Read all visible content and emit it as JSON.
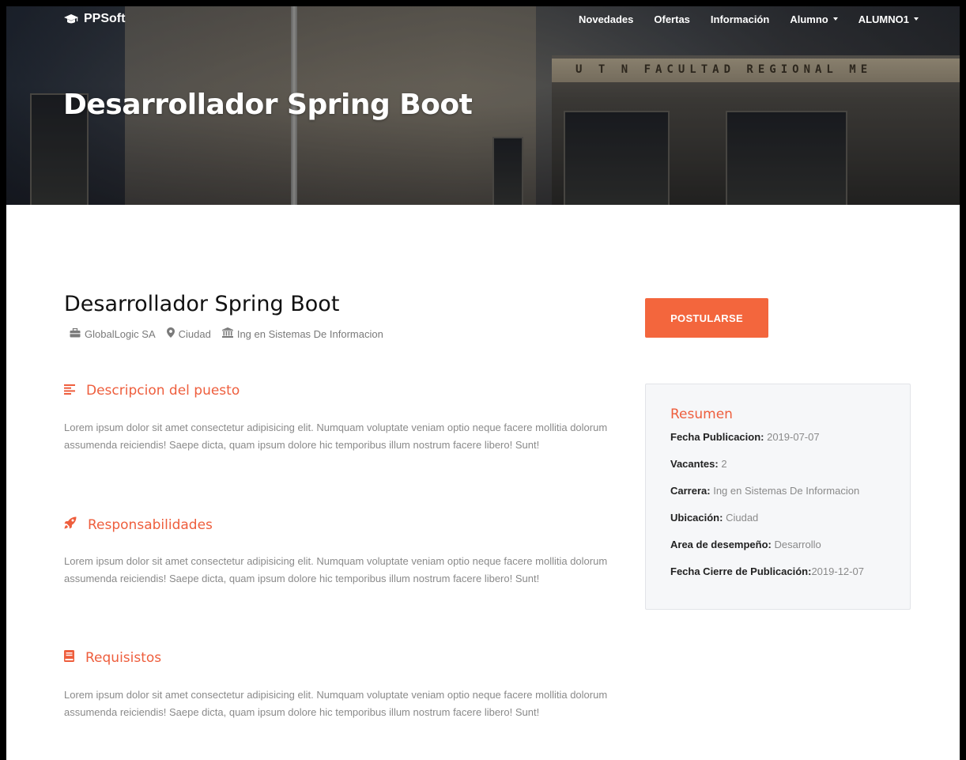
{
  "nav": {
    "brand": "PPSoft",
    "items": [
      {
        "label": "Novedades"
      },
      {
        "label": "Ofertas"
      },
      {
        "label": "Información"
      },
      {
        "label": "Alumno"
      },
      {
        "label": "ALUMNO1"
      }
    ]
  },
  "hero": {
    "title": "Desarrollador Spring Boot",
    "sign_text": "U T N   FACULTAD   REGIONAL   ME"
  },
  "job": {
    "title": "Desarrollador Spring Boot",
    "company": "GlobalLogic SA",
    "location": "Ciudad",
    "career": "Ing en Sistemas De Informacion"
  },
  "sections": [
    {
      "title": "Descripcion del puesto",
      "icon": "align-left-icon",
      "text": "Lorem ipsum dolor sit amet consectetur adipisicing elit. Numquam voluptate veniam optio neque facere mollitia dolorum assumenda reiciendis! Saepe dicta, quam ipsum dolore hic temporibus illum nostrum facere libero! Sunt!"
    },
    {
      "title": "Responsabilidades",
      "icon": "rocket-icon",
      "text": "Lorem ipsum dolor sit amet consectetur adipisicing elit. Numquam voluptate veniam optio neque facere mollitia dolorum assumenda reiciendis! Saepe dicta, quam ipsum dolore hic temporibus illum nostrum facere libero! Sunt!"
    },
    {
      "title": "Requisistos",
      "icon": "book-icon",
      "text": "Lorem ipsum dolor sit amet consectetur adipisicing elit. Numquam voluptate veniam optio neque facere mollitia dolorum assumenda reiciendis! Saepe dicta, quam ipsum dolore hic temporibus illum nostrum facere libero! Sunt!"
    }
  ],
  "apply_label": "POSTULARSE",
  "summary": {
    "title": "Resumen",
    "rows": [
      {
        "label": "Fecha Publicacion: ",
        "value": "2019-07-07"
      },
      {
        "label": "Vacantes: ",
        "value": "2"
      },
      {
        "label": "Carrera: ",
        "value": "Ing en Sistemas De Informacion"
      },
      {
        "label": "Ubicación: ",
        "value": "Ciudad"
      },
      {
        "label": "Area de desempeño: ",
        "value": "Desarrollo"
      },
      {
        "label": "Fecha Cierre de Publicación:",
        "value": "2019-12-07"
      }
    ]
  },
  "colors": {
    "accent": "#f3663d",
    "heading_accent": "#ee5e3d",
    "body_text": "#8a8a8a",
    "summary_bg": "#f6f7f9"
  }
}
